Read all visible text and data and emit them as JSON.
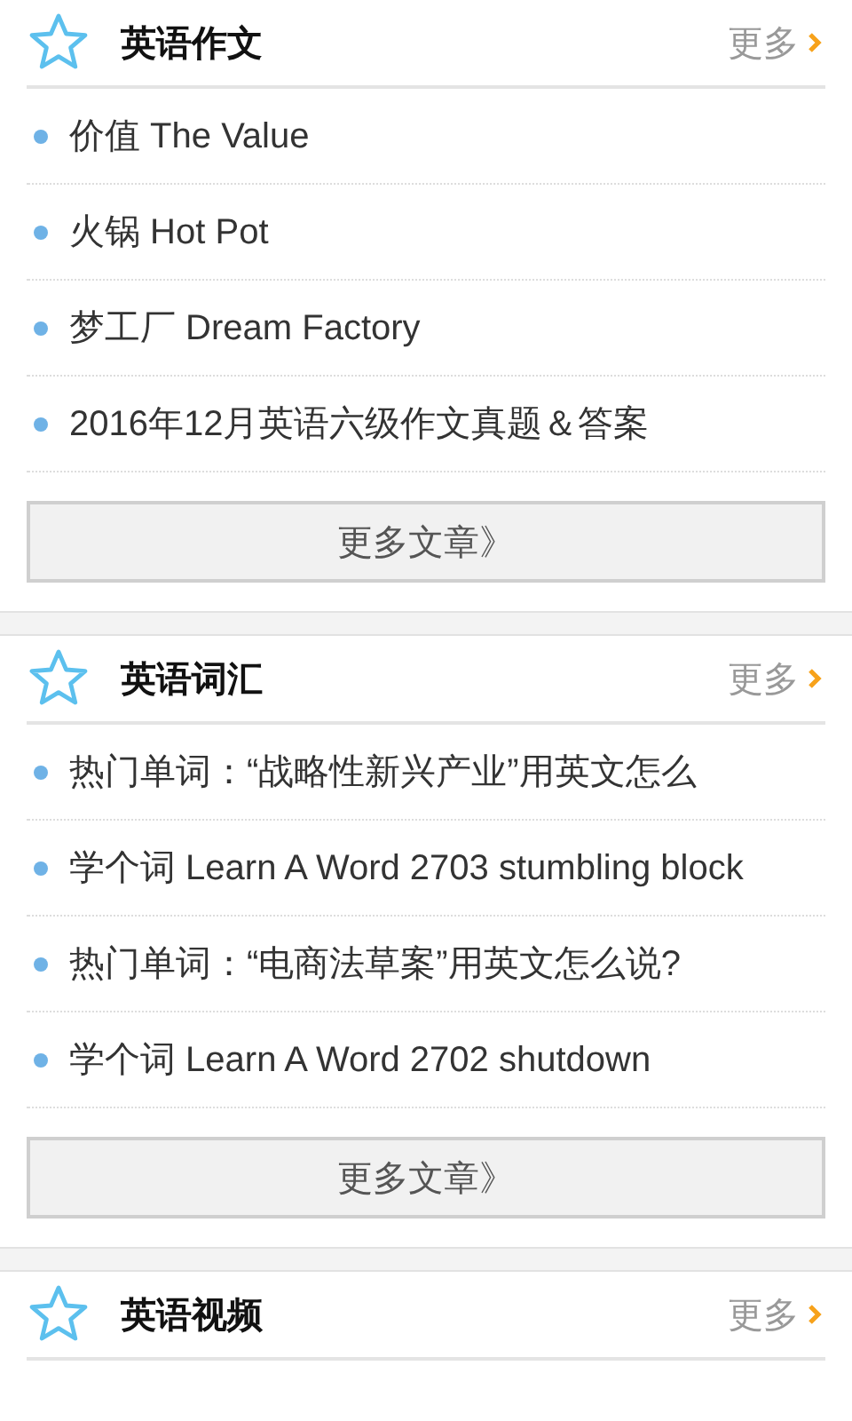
{
  "sections": [
    {
      "title": "英语作文",
      "more_link": "更多",
      "items": [
        "价值 The Value",
        "火锅 Hot Pot",
        "梦工厂 Dream Factory",
        "2016年12月英语六级作文真题＆答案"
      ],
      "more_button": "更多文章》"
    },
    {
      "title": "英语词汇",
      "more_link": "更多",
      "items": [
        "热门单词：“战略性新兴产业”用英文怎么",
        "学个词 Learn A Word 2703 stumbling block",
        "热门单词：“电商法草案”用英文怎么说?",
        "学个词 Learn A Word 2702 shutdown"
      ],
      "more_button": "更多文章》"
    },
    {
      "title": "英语视频",
      "more_link": "更多"
    }
  ]
}
